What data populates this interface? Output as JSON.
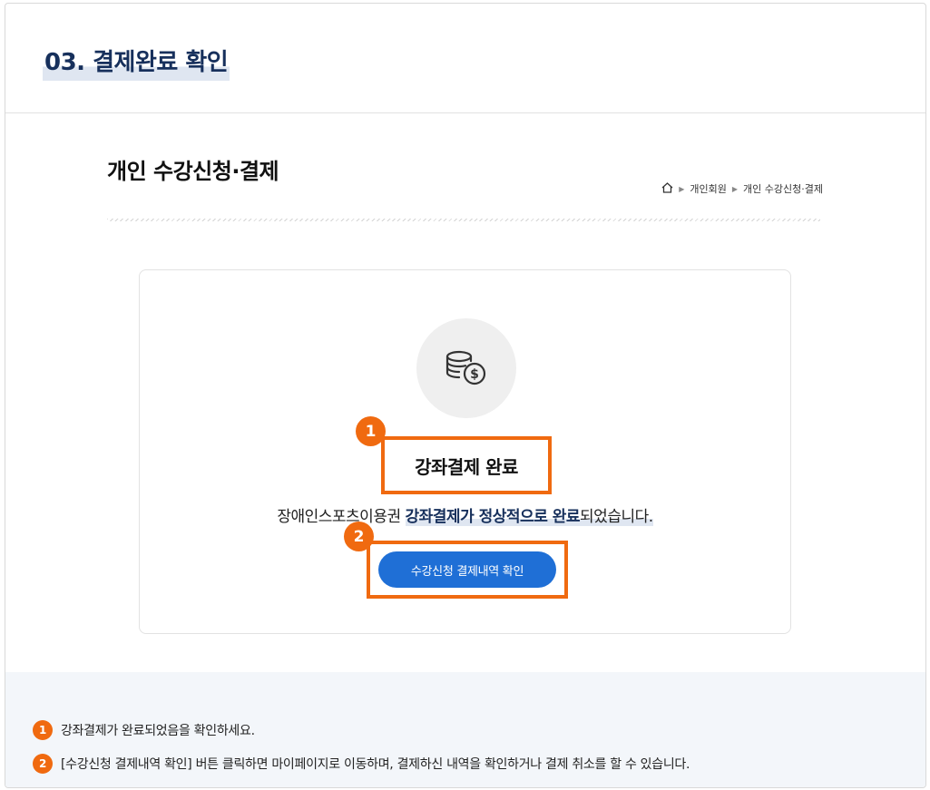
{
  "step_header": {
    "title": "03. 결제완료 확인"
  },
  "page": {
    "title": "개인 수강신청·결제",
    "breadcrumb": [
      "개인회원",
      "개인 수강신청·결제"
    ]
  },
  "card": {
    "icon": "coins-dollar-icon",
    "title": "강좌결제 완료",
    "desc_prefix": "장애인스포츠이용권 ",
    "desc_highlight": "강좌결제가 정상적으로 완료",
    "desc_suffix": "되었습니다.",
    "button_label": "수강신청 결제내역 확인"
  },
  "badges": [
    "1",
    "2"
  ],
  "notes": [
    {
      "num": "1",
      "text": "강좌결제가 완료되었음을 확인하세요."
    },
    {
      "num": "2",
      "text": "[수강신청 결제내역 확인] 버튼 클릭하면 마이페이지로 이동하며, 결제하신 내역을 확인하거나 결제 취소를 할 수 있습니다."
    }
  ],
  "colors": {
    "accent_orange": "#f06a10",
    "primary_blue": "#1f6fd6",
    "navy": "#17305c"
  }
}
